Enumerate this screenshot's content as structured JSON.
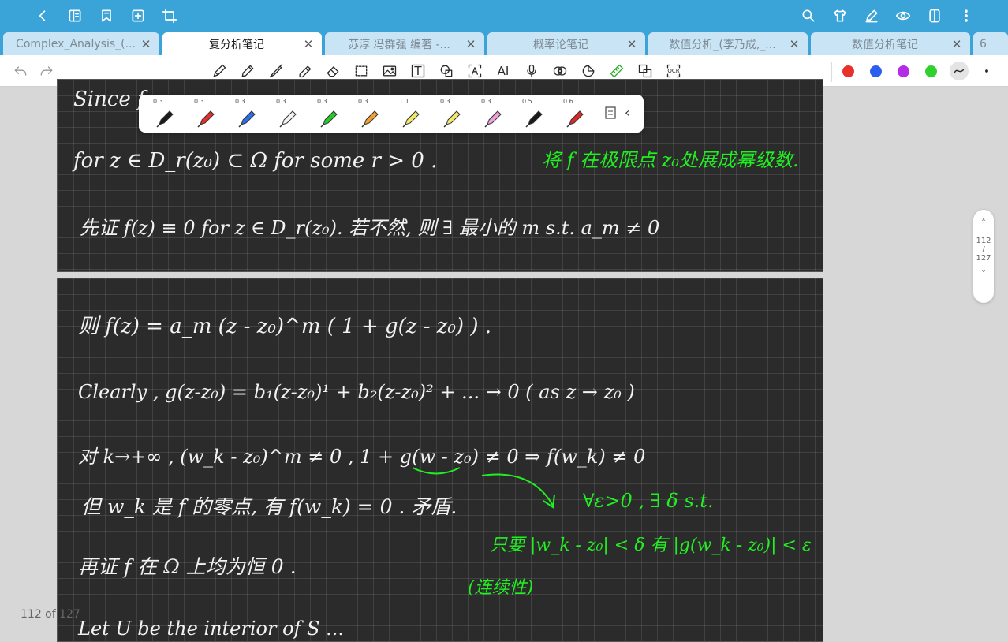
{
  "top_bar": {
    "icons": [
      "back-icon",
      "sidebar-icon",
      "bookmark-icon",
      "add-page-icon",
      "crop-icon",
      "search-icon",
      "shirt-icon",
      "pen-edit-icon",
      "eye-icon",
      "split-view-icon",
      "more-icon"
    ]
  },
  "tabs": [
    {
      "label": "Complex_Analysis_(...",
      "active": false
    },
    {
      "label": "复分析笔记",
      "active": true
    },
    {
      "label": "苏淳 冯群强 编著 -...",
      "active": false
    },
    {
      "label": "概率论笔记",
      "active": false
    },
    {
      "label": "数值分析_(李乃成,_...",
      "active": false
    },
    {
      "label": "数值分析笔记",
      "active": false
    },
    {
      "label": "6",
      "active": false
    }
  ],
  "toolbar": {
    "text_tool": "T",
    "ai_tool": "AI",
    "ocr_tool": "OCR",
    "colors": [
      "#e8312a",
      "#2b5ff0",
      "#b42be8",
      "#2fd12f"
    ]
  },
  "pen_palette": {
    "pens": [
      {
        "size": "0.3",
        "color": "#1a1a1a"
      },
      {
        "size": "0.3",
        "color": "#e0302a"
      },
      {
        "size": "0.3",
        "color": "#2b6ee8"
      },
      {
        "size": "0.3",
        "color": "#f4f4f4"
      },
      {
        "size": "0.3",
        "color": "#28c928"
      },
      {
        "size": "0.3",
        "color": "#f0a030"
      },
      {
        "size": "1.1",
        "color": "#f2e86a"
      },
      {
        "size": "0.3",
        "color": "#f2e86a"
      },
      {
        "size": "0.3",
        "color": "#f0a0d8"
      },
      {
        "size": "0.5",
        "color": "#1a1a1a"
      },
      {
        "size": "0.6",
        "color": "#d82a2a"
      }
    ]
  },
  "page1": {
    "lines": [
      "Since f",
      "for  z ∈ D_r(z₀) ⊂ Ω   for some  r > 0 .",
      "先证  f(z) ≡ 0   for   z ∈ D_r(z₀).   若不然, 则 ∃ 最小的 m  s.t.  a_m ≠ 0"
    ],
    "green_note": "将 f 在极限点 z₀处展成幂级数."
  },
  "page2": {
    "lines": [
      "则  f(z) =  a_m (z - z₀)^m ( 1 + g(z - z₀) ) .",
      "Clearly ,   g(z-z₀) = b₁(z-z₀)¹ + b₂(z-z₀)² + ...      → 0    ( as  z → z₀ )",
      "对 k→+∞ ,  (w_k - z₀)^m ≠ 0 ,      1 + g(w - z₀) ≠ 0   ⇒  f(w_k) ≠ 0",
      "但 w_k 是 f 的零点,   有  f(w_k) = 0 .   矛盾.",
      "再证 f 在 Ω 上均为恒 0 .",
      "Let  U  be  the  interior  of  S ..."
    ],
    "green_notes": [
      "∀ε>0 ,  ∃ δ   s.t.",
      "只要 |w_k - z₀| < δ  有  |g(w_k - z₀)| < ε",
      "(连续性)"
    ]
  },
  "scroller": {
    "current": "112",
    "sep": "/",
    "total": "127"
  },
  "page_indicator": "112 of 127"
}
